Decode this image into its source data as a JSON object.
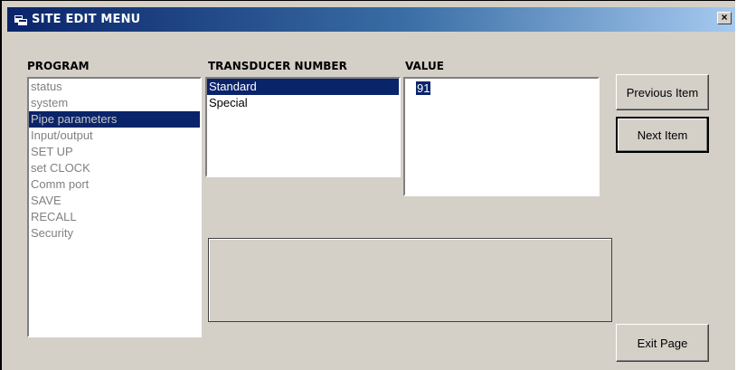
{
  "window": {
    "title": "SITE EDIT MENU",
    "close_label": "×"
  },
  "program": {
    "label": "PROGRAM",
    "items": [
      {
        "label": "status"
      },
      {
        "label": "system"
      },
      {
        "label": "Pipe parameters"
      },
      {
        "label": "Input/output"
      },
      {
        "label": "SET UP"
      },
      {
        "label": "set CLOCK"
      },
      {
        "label": "Comm port"
      },
      {
        "label": "SAVE"
      },
      {
        "label": "RECALL"
      },
      {
        "label": "Security"
      }
    ],
    "selected": "Pipe parameters"
  },
  "transducer": {
    "label": "TRANSDUCER NUMBER",
    "items": [
      {
        "label": "Standard"
      },
      {
        "label": "Special"
      }
    ],
    "selected": "Standard"
  },
  "value": {
    "label": "VALUE",
    "current": "91"
  },
  "buttons": {
    "previous": "Previous Item",
    "next": "Next Item",
    "exit": "Exit Page"
  },
  "colors": {
    "title_gradient_start": "#0a246a",
    "title_gradient_end": "#a6caf0",
    "selection": "#0a246a",
    "window_background": "#d4d0c8"
  }
}
